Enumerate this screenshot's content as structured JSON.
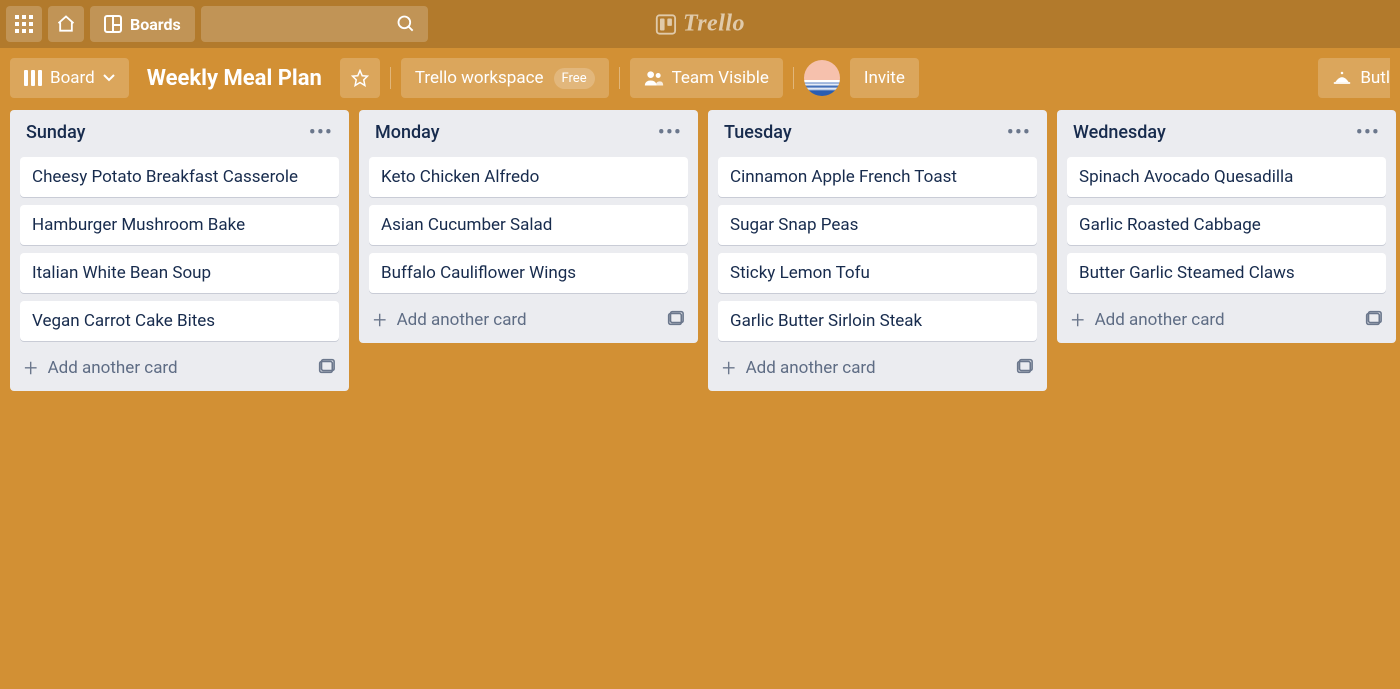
{
  "brand": "Trello",
  "header": {
    "boards_label": "Boards"
  },
  "board": {
    "view_label": "Board",
    "title": "Weekly Meal Plan",
    "workspace_label": "Trello workspace",
    "workspace_badge": "Free",
    "visibility_label": "Team Visible",
    "invite_label": "Invite",
    "butler_label": "Butl"
  },
  "add_card_label": "Add another card",
  "lists": [
    {
      "title": "Sunday",
      "cards": [
        "Cheesy Potato Breakfast Casserole",
        "Hamburger Mushroom Bake",
        "Italian White Bean Soup",
        "Vegan Carrot Cake Bites"
      ]
    },
    {
      "title": "Monday",
      "cards": [
        "Keto Chicken Alfredo",
        "Asian Cucumber Salad",
        "Buffalo Cauliflower Wings"
      ]
    },
    {
      "title": "Tuesday",
      "cards": [
        "Cinnamon Apple French Toast",
        "Sugar Snap Peas",
        "Sticky Lemon Tofu",
        "Garlic Butter Sirloin Steak"
      ]
    },
    {
      "title": "Wednesday",
      "cards": [
        "Spinach Avocado Quesadilla",
        "Garlic Roasted Cabbage",
        "Butter Garlic Steamed Claws"
      ]
    }
  ]
}
